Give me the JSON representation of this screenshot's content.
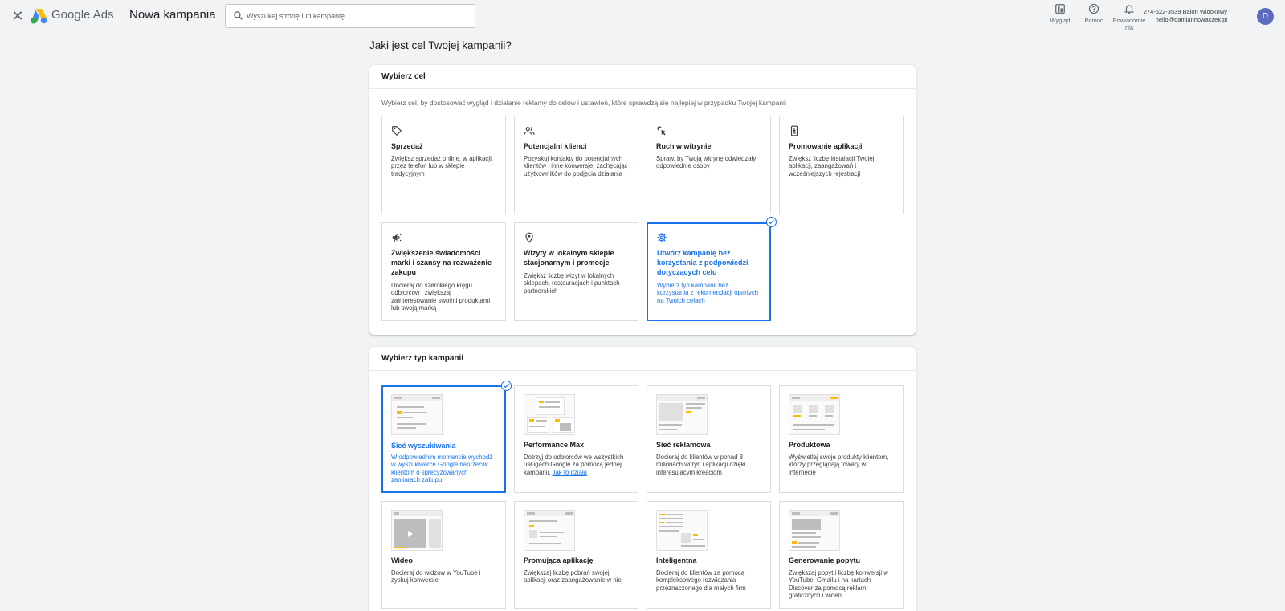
{
  "header": {
    "brand": "Google Ads",
    "title": "Nowa kampania",
    "search_placeholder": "Wyszukaj stronę lub kampanię",
    "tools": [
      {
        "label": "Wygląd",
        "icon": "appearance-icon"
      },
      {
        "label": "Pomoc",
        "icon": "help-icon"
      },
      {
        "label": "Powiadomie nia",
        "icon": "bell-icon"
      }
    ],
    "account_id": "274-622-3539 Balon Widokowy",
    "account_email": "hello@damiannowaczek.pl",
    "avatar_letter": "D"
  },
  "question": "Jaki jest cel Twojej kampanii?",
  "goal_section": {
    "title": "Wybierz cel",
    "description": "Wybierz cel, by dostosować wygląd i działanie reklamy do celów i ustawień, które sprawdzą się najlepiej w przypadku Twojej kampanii",
    "goals": [
      {
        "title": "Sprzedaż",
        "desc": "Zwiększ sprzedaż online, w aplikacji, przez telefon lub w sklepie tradycyjnym",
        "icon": "tag-icon"
      },
      {
        "title": "Potencjalni klienci",
        "desc": "Pozyskuj kontakty do potencjalnych klientów i inne konwersje, zachęcając użytkowników do podjęcia działania",
        "icon": "people-icon"
      },
      {
        "title": "Ruch w witrynie",
        "desc": "Spraw, by Twoją witrynę odwiedzały odpowiednie osoby",
        "icon": "click-icon"
      },
      {
        "title": "Promowanie aplikacji",
        "desc": "Zwiększ liczbę instalacji Twojej aplikacji, zaangażowań i wcześniejszych rejestracji",
        "icon": "phone-download-icon"
      },
      {
        "title": "Zwiększenie świadomości marki i szansy na rozważenie zakupu",
        "desc": "Docieraj do szerokiego kręgu odbiorców i zwiększaj zainteresowanie swoimi produktami lub swoją marką",
        "icon": "megaphone-icon"
      },
      {
        "title": "Wizyty w lokalnym sklepie stacjonarnym i promocje",
        "desc": "Zwiększ liczbę wizyt w lokalnych sklepach, restauracjach i punktach partnerskich",
        "icon": "location-pin-icon"
      },
      {
        "title": "Utwórz kampanię bez korzystania z podpowiedzi dotyczących celu",
        "desc": "Wybierz typ kampanii bez korzystania z rekomendacji opartych na Twoich celach",
        "icon": "gear-icon",
        "selected": true
      }
    ]
  },
  "type_section": {
    "title": "Wybierz typ kampanii",
    "types": [
      {
        "title": "Sieć wyszukiwania",
        "desc": "W odpowiednim momencie wychodź w wyszukiwarce Google naprzeciw klientom o sprecyzowanych zamiarach zakupu",
        "selected": true
      },
      {
        "title": "Performance Max",
        "desc": "Dotrzyj do odbiorców we wszystkich usługach Google za pomocą jednej kampanii.",
        "link": "Jak to działa"
      },
      {
        "title": "Sieć reklamowa",
        "desc": "Docieraj do klientów w ponad 3 milionach witryn i aplikacji dzięki interesującym kreacjom"
      },
      {
        "title": "Produktowa",
        "desc": "Wyświetlaj swoje produkty klientom, którzy przeglądają towary w internecie"
      },
      {
        "title": "Wideo",
        "desc": "Docieraj do widzów w YouTube i zyskuj konwersje"
      },
      {
        "title": "Promująca aplikację",
        "desc": "Zwiększaj liczbę pobrań swojej aplikacji oraz zaangażowanie w niej"
      },
      {
        "title": "Inteligentna",
        "desc": "Docieraj do klientów za pomocą kompleksowego rozwiązania przeznaczonego dla małych firm"
      },
      {
        "title": "Generowanie popytu",
        "desc": "Zwiększaj popyt i liczbę konwersji w YouTube, Gmailu i na kartach Discover za pomocą reklam graficznych i wideo"
      }
    ]
  },
  "colors": {
    "accent": "#1a73e8",
    "background": "#f1f3f4",
    "avatar": "#5c6bc0",
    "highlight": "#fbbc04"
  }
}
